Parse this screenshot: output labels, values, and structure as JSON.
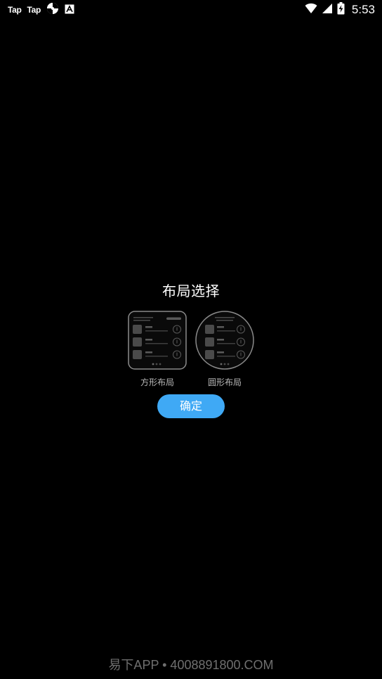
{
  "status_bar": {
    "left_labels": [
      "Tap",
      "Tap"
    ],
    "icons": [
      "pinwheel-icon",
      "font-app-icon"
    ],
    "right_icons": [
      "wifi-icon",
      "signal-icon",
      "battery-charging-icon"
    ],
    "time": "5:53"
  },
  "dialog": {
    "title": "布局选择",
    "options": [
      {
        "label": "方形布局",
        "shape": "square"
      },
      {
        "label": "圆形布局",
        "shape": "circle"
      }
    ],
    "confirm_label": "确定",
    "confirm_color": "#3fa9f5"
  },
  "watermark": "易下APP • 4008891800.COM"
}
